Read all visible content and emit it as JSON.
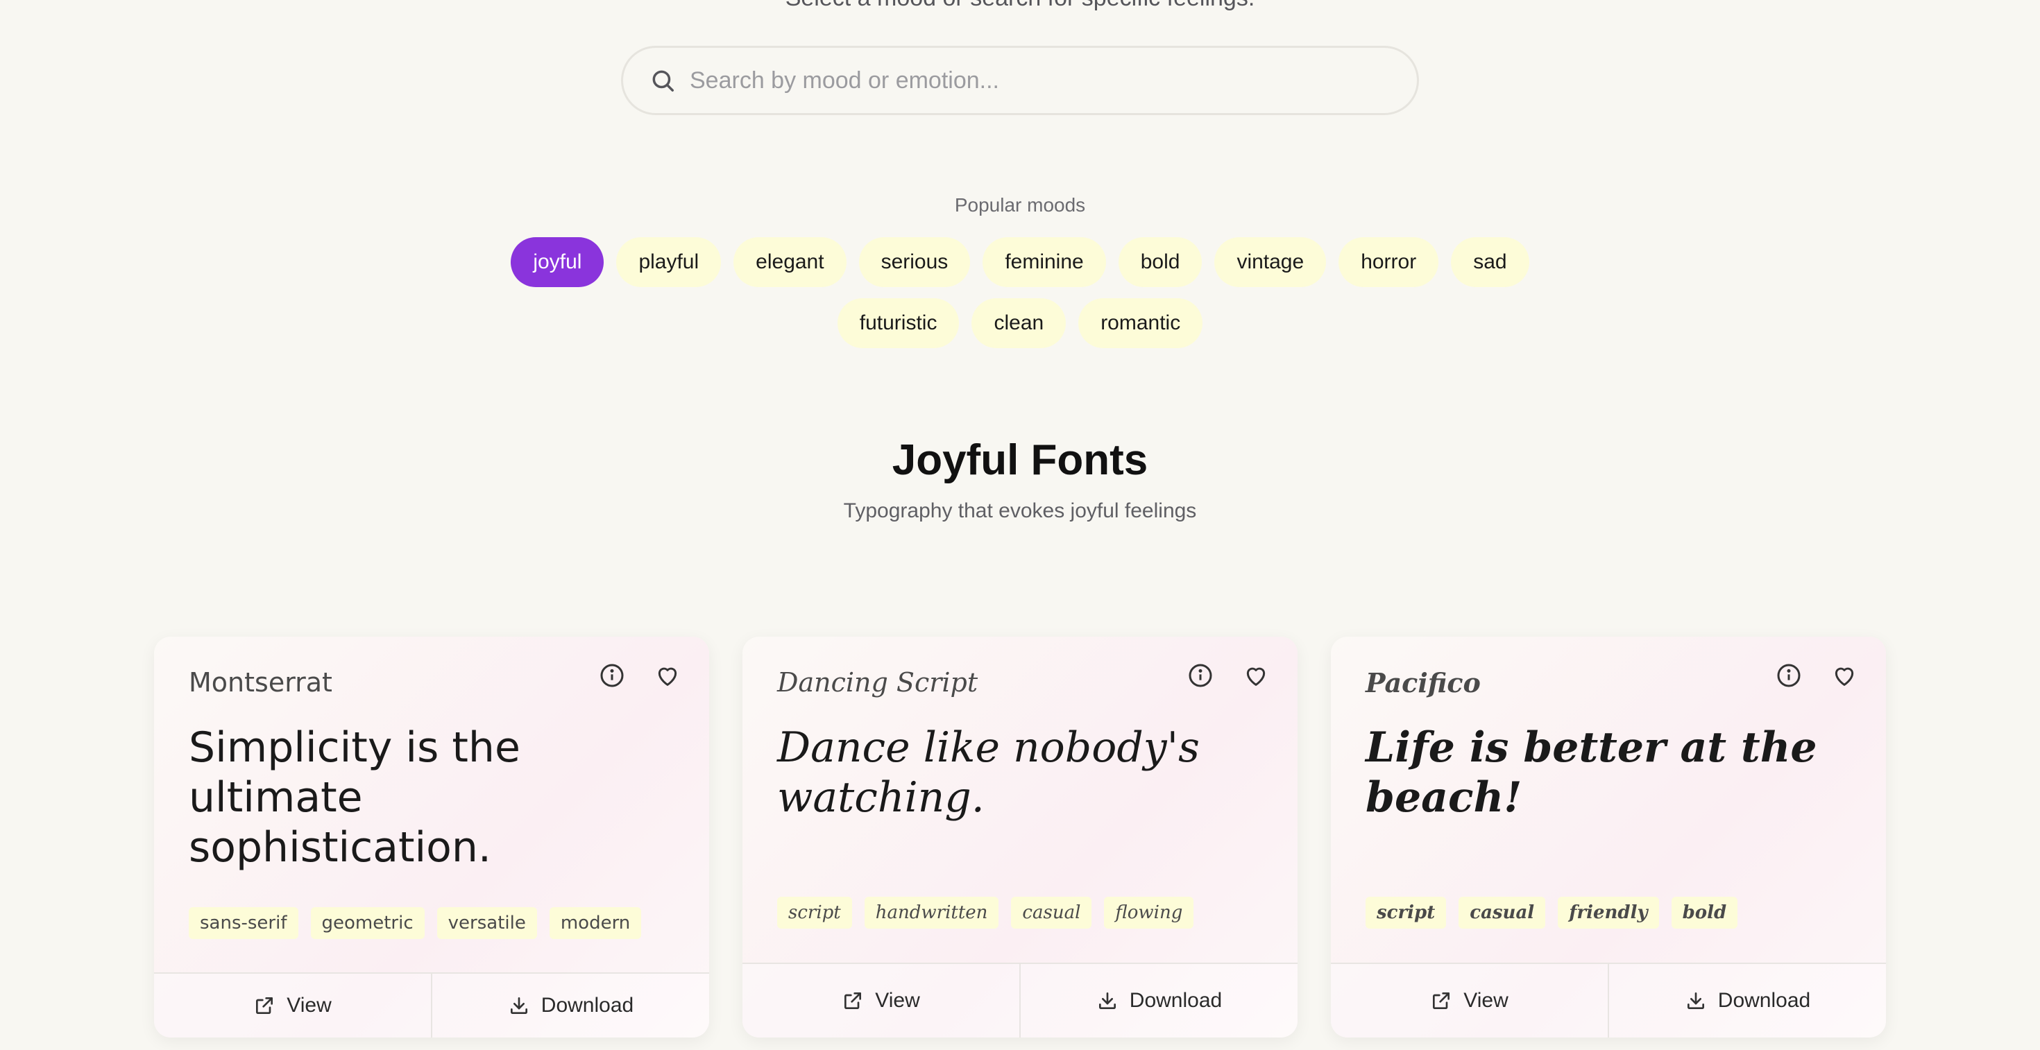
{
  "header": {
    "subtitle": "Select a mood or search for specific feelings."
  },
  "search": {
    "placeholder": "Search by mood or emotion...",
    "value": ""
  },
  "moods": {
    "label": "Popular moods",
    "row1": [
      "joyful",
      "playful",
      "elegant",
      "serious",
      "feminine",
      "bold",
      "vintage",
      "horror",
      "sad"
    ],
    "row2": [
      "futuristic",
      "clean",
      "romantic"
    ],
    "active": "joyful",
    "active_color": "#8a34dc",
    "chip_color": "#fdfcd8"
  },
  "section": {
    "title": "Joyful Fonts",
    "subtitle": "Typography that evokes joyful feelings"
  },
  "cards": [
    {
      "font_name": "Montserrat",
      "sample": "Simplicity is the ultimate sophistication.",
      "tags": [
        "sans-serif",
        "geometric",
        "versatile",
        "modern"
      ],
      "view_label": "View",
      "download_label": "Download"
    },
    {
      "font_name": "Dancing Script",
      "sample": "Dance like nobody's watching.",
      "tags": [
        "script",
        "handwritten",
        "casual",
        "flowing"
      ],
      "view_label": "View",
      "download_label": "Download"
    },
    {
      "font_name": "Pacifico",
      "sample": "Life is better at the beach!",
      "tags": [
        "script",
        "casual",
        "friendly",
        "bold"
      ],
      "view_label": "View",
      "download_label": "Download"
    }
  ],
  "icons": {
    "search": "search-icon",
    "info": "info-icon",
    "favorite": "heart-icon",
    "view": "external-link-icon",
    "download": "download-icon"
  }
}
